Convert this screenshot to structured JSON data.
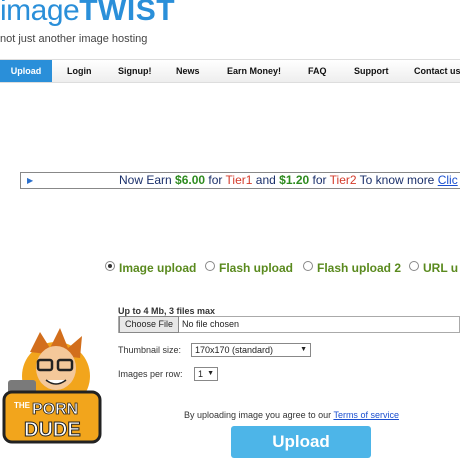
{
  "logo": {
    "part1": "image",
    "part2": "TWIST",
    "tagline": "not just another image hosting"
  },
  "nav": {
    "items": [
      "Upload",
      "Login",
      "Signup!",
      "News",
      "Earn Money!",
      "FAQ",
      "Support",
      "Contact us"
    ]
  },
  "banner": {
    "prefix": "Now Earn ",
    "amount1": "$6.00",
    "for1": " for ",
    "tier1": "Tier1",
    "and": " and ",
    "amount2": "$1.20",
    "for2": " for ",
    "tier2": "Tier2",
    "know": " To know more ",
    "link": "Clic"
  },
  "upload_types": [
    {
      "label": "Image upload",
      "selected": true
    },
    {
      "label": "Flash upload",
      "selected": false
    },
    {
      "label": "Flash upload 2",
      "selected": false
    },
    {
      "label": "URL u",
      "selected": false
    }
  ],
  "form": {
    "limit": "Up to 4 Mb, 3 files max",
    "choose_file": "Choose File",
    "no_file": "No file chosen",
    "thumb_label": "Thumbnail size:",
    "thumb_value": "170x170 (standard)",
    "per_row_label": "Images per row:",
    "per_row_value": "1",
    "agree_text": "By uploading image you agree to our ",
    "tos": "Terms of service",
    "upload_button": "Upload"
  },
  "mascot": {
    "line1": "THE",
    "line2": "PORN",
    "line3": "DUDE"
  },
  "colors": {
    "brand": "#2a8fd9",
    "green": "#5a8a1e",
    "red": "#d43a2a",
    "button": "#4db5e8"
  }
}
